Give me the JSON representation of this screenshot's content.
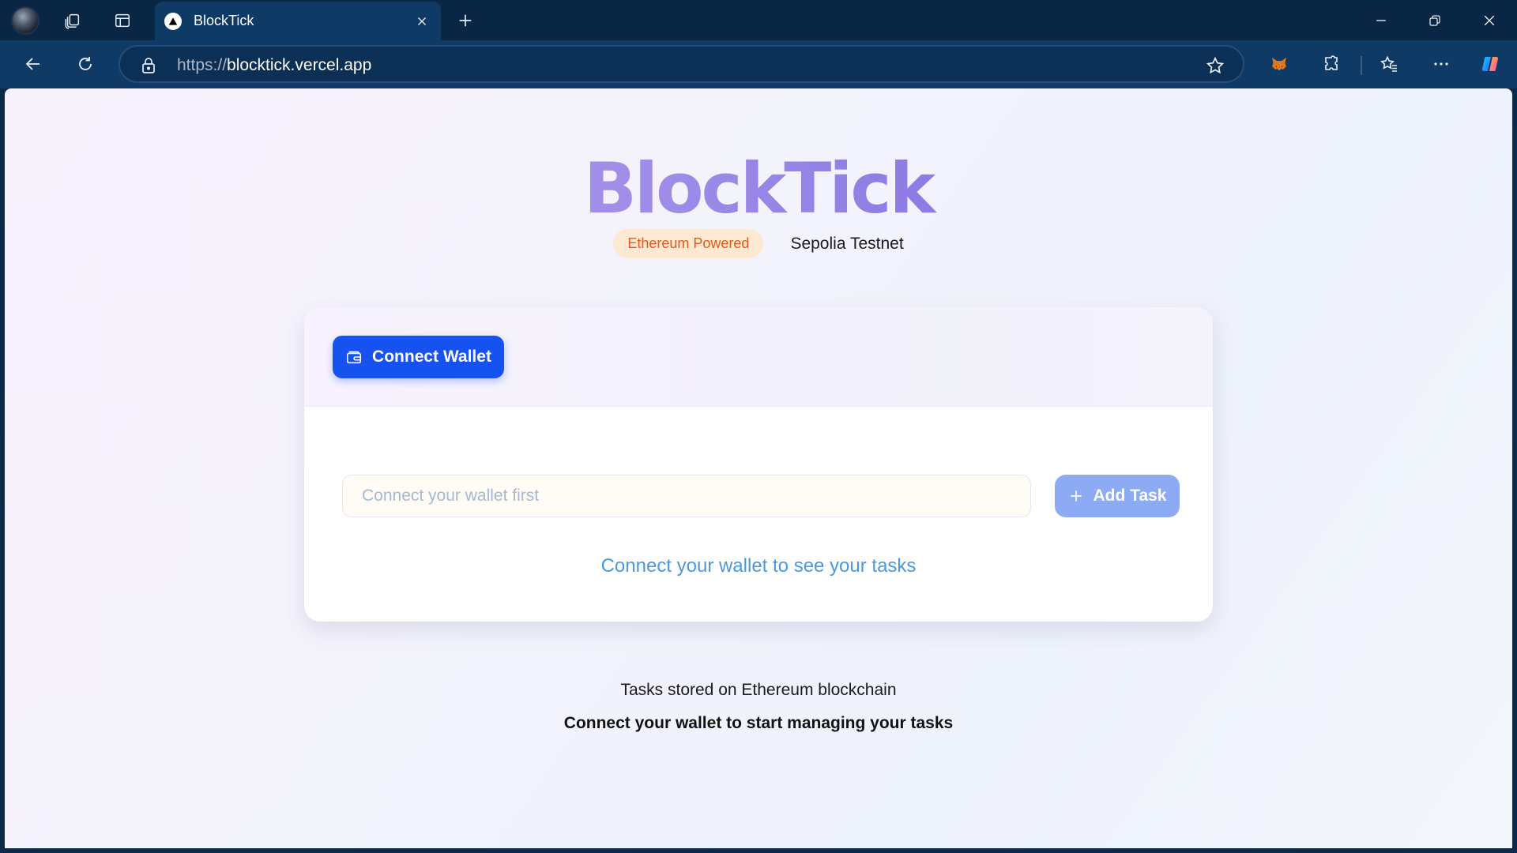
{
  "browser": {
    "tab_title": "BlockTick",
    "url_protocol": "https://",
    "url_host": "blocktick.vercel.app"
  },
  "icons": {
    "profile": "profile-avatar-icon",
    "workspaces": "workspaces-icon",
    "tab_actions": "tab-actions-icon",
    "new_tab": "plus-icon",
    "back": "arrow-left-icon",
    "refresh": "refresh-icon",
    "lock": "lock-icon",
    "favorite": "star-icon",
    "metamask": "fox-icon",
    "extensions": "puzzle-icon",
    "favorites": "favorites-icon",
    "more": "ellipsis-icon",
    "copilot": "copilot-icon",
    "wallet": "wallet-icon",
    "add": "plus-icon"
  },
  "app": {
    "logo": "BlockTick",
    "badge_powered": "Ethereum Powered",
    "badge_network": "Sepolia Testnet"
  },
  "card": {
    "connect_label": "Connect Wallet",
    "input_placeholder": "Connect your wallet first",
    "input_value": "",
    "add_label": "Add Task",
    "empty_message": "Connect your wallet to see your tasks"
  },
  "footer": {
    "line1": "Tasks stored on Ethereum blockchain",
    "line2": "Connect your wallet to start managing your tasks"
  },
  "colors": {
    "chrome_dark": "#0a2645",
    "chrome": "#0f3a66",
    "primary": "#1652f0",
    "primary_disabled": "#8daaf5",
    "badge_bg": "#fde9d2",
    "badge_text": "#e4581a",
    "link_blue": "#4a98e0"
  }
}
